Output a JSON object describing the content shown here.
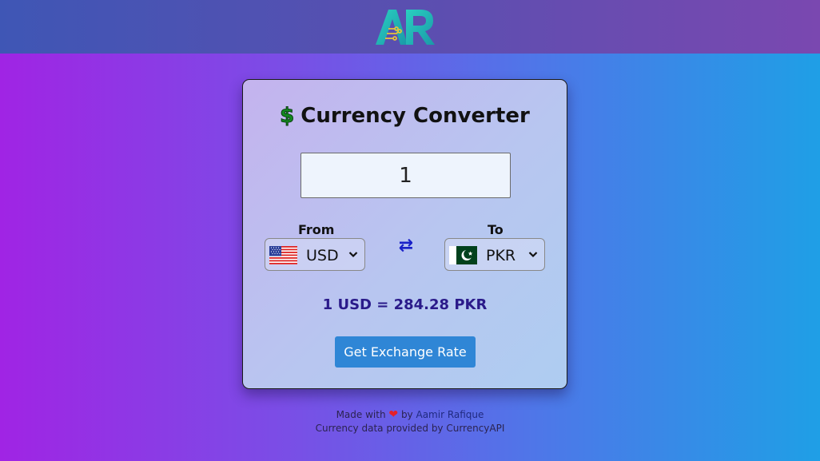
{
  "header": {
    "logo_text": "AR",
    "colors": {
      "logo_primary": "#1fb5b0",
      "logo_accent": "#e6c23a"
    }
  },
  "converter": {
    "title_icon": "$",
    "title": "Currency Converter",
    "amount_value": "1",
    "from_label": "From",
    "to_label": "To",
    "from_currency": "USD",
    "to_currency": "PKR",
    "from_flag_icon": "us-flag-icon",
    "to_flag_icon": "pk-flag-icon",
    "swap_icon": "⇄",
    "result_text": "1 USD = 284.28 PKR",
    "button_label": "Get Exchange Rate"
  },
  "footer": {
    "made_with": "Made with",
    "heart": "❤",
    "by": "by",
    "author": "Aamir Rafique",
    "credit": "Currency data provided by CurrencyAPI"
  },
  "colors": {
    "button": "#2f86d6",
    "result": "#2a1a8a",
    "swap": "#1820c8"
  }
}
